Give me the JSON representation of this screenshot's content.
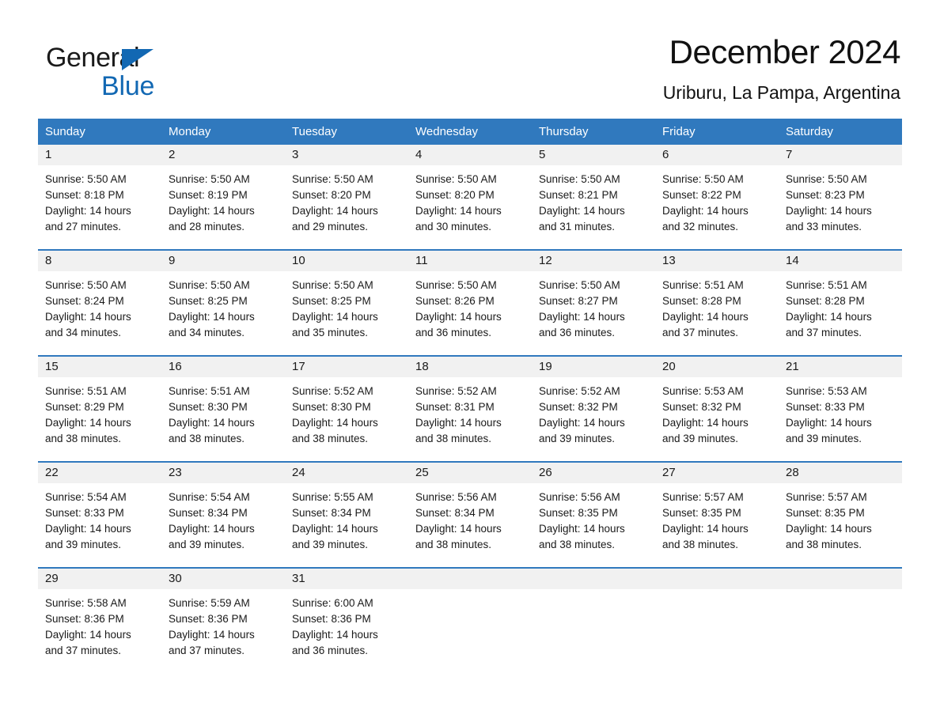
{
  "logo": {
    "word_general": "General",
    "word_blue": "Blue",
    "triangle_color": "#1268b3",
    "blue_text_color": "#1268b3"
  },
  "header": {
    "title": "December 2024",
    "location": "Uriburu, La Pampa, Argentina"
  },
  "theme": {
    "header_blue": "#3079be",
    "daynum_band": "#f1f1f1",
    "text": "#1a1a1a"
  },
  "weekdays": [
    "Sunday",
    "Monday",
    "Tuesday",
    "Wednesday",
    "Thursday",
    "Friday",
    "Saturday"
  ],
  "labels": {
    "sunrise_prefix": "Sunrise:",
    "sunset_prefix": "Sunset:",
    "daylight_prefix": "Daylight:"
  },
  "weeks": [
    [
      {
        "day": "1",
        "sunrise": "Sunrise: 5:50 AM",
        "sunset": "Sunset: 8:18 PM",
        "daylight_1": "Daylight: 14 hours",
        "daylight_2": "and 27 minutes."
      },
      {
        "day": "2",
        "sunrise": "Sunrise: 5:50 AM",
        "sunset": "Sunset: 8:19 PM",
        "daylight_1": "Daylight: 14 hours",
        "daylight_2": "and 28 minutes."
      },
      {
        "day": "3",
        "sunrise": "Sunrise: 5:50 AM",
        "sunset": "Sunset: 8:20 PM",
        "daylight_1": "Daylight: 14 hours",
        "daylight_2": "and 29 minutes."
      },
      {
        "day": "4",
        "sunrise": "Sunrise: 5:50 AM",
        "sunset": "Sunset: 8:20 PM",
        "daylight_1": "Daylight: 14 hours",
        "daylight_2": "and 30 minutes."
      },
      {
        "day": "5",
        "sunrise": "Sunrise: 5:50 AM",
        "sunset": "Sunset: 8:21 PM",
        "daylight_1": "Daylight: 14 hours",
        "daylight_2": "and 31 minutes."
      },
      {
        "day": "6",
        "sunrise": "Sunrise: 5:50 AM",
        "sunset": "Sunset: 8:22 PM",
        "daylight_1": "Daylight: 14 hours",
        "daylight_2": "and 32 minutes."
      },
      {
        "day": "7",
        "sunrise": "Sunrise: 5:50 AM",
        "sunset": "Sunset: 8:23 PM",
        "daylight_1": "Daylight: 14 hours",
        "daylight_2": "and 33 minutes."
      }
    ],
    [
      {
        "day": "8",
        "sunrise": "Sunrise: 5:50 AM",
        "sunset": "Sunset: 8:24 PM",
        "daylight_1": "Daylight: 14 hours",
        "daylight_2": "and 34 minutes."
      },
      {
        "day": "9",
        "sunrise": "Sunrise: 5:50 AM",
        "sunset": "Sunset: 8:25 PM",
        "daylight_1": "Daylight: 14 hours",
        "daylight_2": "and 34 minutes."
      },
      {
        "day": "10",
        "sunrise": "Sunrise: 5:50 AM",
        "sunset": "Sunset: 8:25 PM",
        "daylight_1": "Daylight: 14 hours",
        "daylight_2": "and 35 minutes."
      },
      {
        "day": "11",
        "sunrise": "Sunrise: 5:50 AM",
        "sunset": "Sunset: 8:26 PM",
        "daylight_1": "Daylight: 14 hours",
        "daylight_2": "and 36 minutes."
      },
      {
        "day": "12",
        "sunrise": "Sunrise: 5:50 AM",
        "sunset": "Sunset: 8:27 PM",
        "daylight_1": "Daylight: 14 hours",
        "daylight_2": "and 36 minutes."
      },
      {
        "day": "13",
        "sunrise": "Sunrise: 5:51 AM",
        "sunset": "Sunset: 8:28 PM",
        "daylight_1": "Daylight: 14 hours",
        "daylight_2": "and 37 minutes."
      },
      {
        "day": "14",
        "sunrise": "Sunrise: 5:51 AM",
        "sunset": "Sunset: 8:28 PM",
        "daylight_1": "Daylight: 14 hours",
        "daylight_2": "and 37 minutes."
      }
    ],
    [
      {
        "day": "15",
        "sunrise": "Sunrise: 5:51 AM",
        "sunset": "Sunset: 8:29 PM",
        "daylight_1": "Daylight: 14 hours",
        "daylight_2": "and 38 minutes."
      },
      {
        "day": "16",
        "sunrise": "Sunrise: 5:51 AM",
        "sunset": "Sunset: 8:30 PM",
        "daylight_1": "Daylight: 14 hours",
        "daylight_2": "and 38 minutes."
      },
      {
        "day": "17",
        "sunrise": "Sunrise: 5:52 AM",
        "sunset": "Sunset: 8:30 PM",
        "daylight_1": "Daylight: 14 hours",
        "daylight_2": "and 38 minutes."
      },
      {
        "day": "18",
        "sunrise": "Sunrise: 5:52 AM",
        "sunset": "Sunset: 8:31 PM",
        "daylight_1": "Daylight: 14 hours",
        "daylight_2": "and 38 minutes."
      },
      {
        "day": "19",
        "sunrise": "Sunrise: 5:52 AM",
        "sunset": "Sunset: 8:32 PM",
        "daylight_1": "Daylight: 14 hours",
        "daylight_2": "and 39 minutes."
      },
      {
        "day": "20",
        "sunrise": "Sunrise: 5:53 AM",
        "sunset": "Sunset: 8:32 PM",
        "daylight_1": "Daylight: 14 hours",
        "daylight_2": "and 39 minutes."
      },
      {
        "day": "21",
        "sunrise": "Sunrise: 5:53 AM",
        "sunset": "Sunset: 8:33 PM",
        "daylight_1": "Daylight: 14 hours",
        "daylight_2": "and 39 minutes."
      }
    ],
    [
      {
        "day": "22",
        "sunrise": "Sunrise: 5:54 AM",
        "sunset": "Sunset: 8:33 PM",
        "daylight_1": "Daylight: 14 hours",
        "daylight_2": "and 39 minutes."
      },
      {
        "day": "23",
        "sunrise": "Sunrise: 5:54 AM",
        "sunset": "Sunset: 8:34 PM",
        "daylight_1": "Daylight: 14 hours",
        "daylight_2": "and 39 minutes."
      },
      {
        "day": "24",
        "sunrise": "Sunrise: 5:55 AM",
        "sunset": "Sunset: 8:34 PM",
        "daylight_1": "Daylight: 14 hours",
        "daylight_2": "and 39 minutes."
      },
      {
        "day": "25",
        "sunrise": "Sunrise: 5:56 AM",
        "sunset": "Sunset: 8:34 PM",
        "daylight_1": "Daylight: 14 hours",
        "daylight_2": "and 38 minutes."
      },
      {
        "day": "26",
        "sunrise": "Sunrise: 5:56 AM",
        "sunset": "Sunset: 8:35 PM",
        "daylight_1": "Daylight: 14 hours",
        "daylight_2": "and 38 minutes."
      },
      {
        "day": "27",
        "sunrise": "Sunrise: 5:57 AM",
        "sunset": "Sunset: 8:35 PM",
        "daylight_1": "Daylight: 14 hours",
        "daylight_2": "and 38 minutes."
      },
      {
        "day": "28",
        "sunrise": "Sunrise: 5:57 AM",
        "sunset": "Sunset: 8:35 PM",
        "daylight_1": "Daylight: 14 hours",
        "daylight_2": "and 38 minutes."
      }
    ],
    [
      {
        "day": "29",
        "sunrise": "Sunrise: 5:58 AM",
        "sunset": "Sunset: 8:36 PM",
        "daylight_1": "Daylight: 14 hours",
        "daylight_2": "and 37 minutes."
      },
      {
        "day": "30",
        "sunrise": "Sunrise: 5:59 AM",
        "sunset": "Sunset: 8:36 PM",
        "daylight_1": "Daylight: 14 hours",
        "daylight_2": "and 37 minutes."
      },
      {
        "day": "31",
        "sunrise": "Sunrise: 6:00 AM",
        "sunset": "Sunset: 8:36 PM",
        "daylight_1": "Daylight: 14 hours",
        "daylight_2": "and 36 minutes."
      },
      {
        "day": "",
        "sunrise": "",
        "sunset": "",
        "daylight_1": "",
        "daylight_2": ""
      },
      {
        "day": "",
        "sunrise": "",
        "sunset": "",
        "daylight_1": "",
        "daylight_2": ""
      },
      {
        "day": "",
        "sunrise": "",
        "sunset": "",
        "daylight_1": "",
        "daylight_2": ""
      },
      {
        "day": "",
        "sunrise": "",
        "sunset": "",
        "daylight_1": "",
        "daylight_2": ""
      }
    ]
  ]
}
